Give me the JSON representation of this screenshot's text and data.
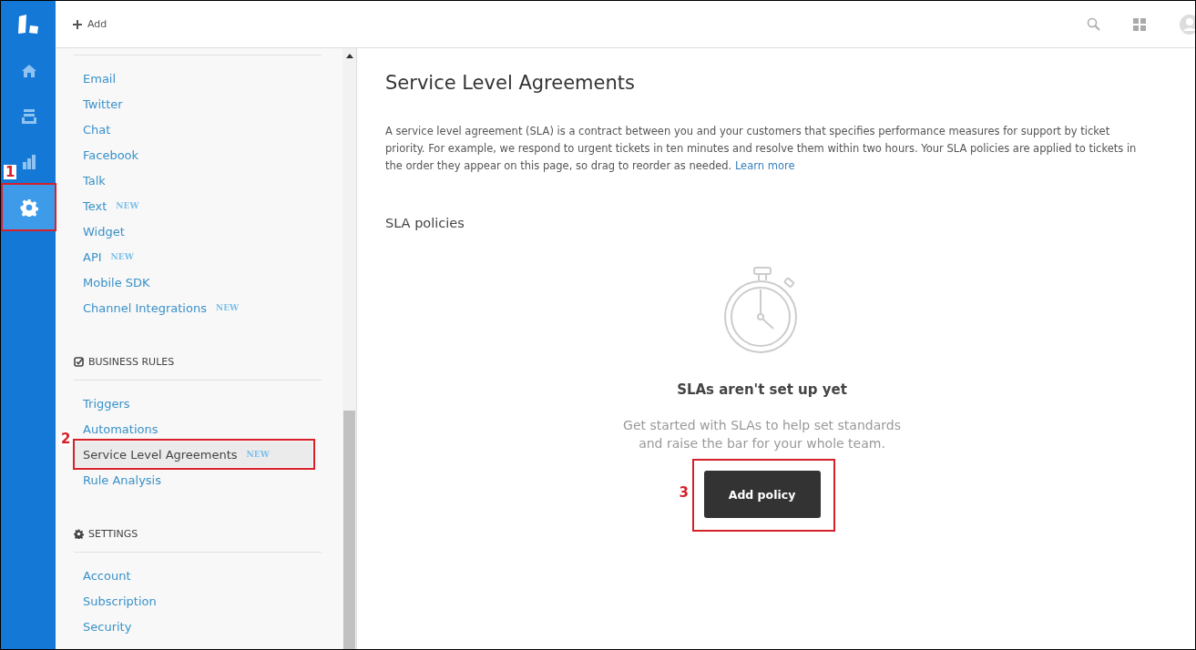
{
  "rail": {
    "items": [
      {
        "selected": false
      },
      {
        "selected": false
      },
      {
        "selected": false
      },
      {
        "selected": true,
        "callout": "1"
      }
    ]
  },
  "top_bar": {
    "add_label": "Add"
  },
  "sidebar": {
    "groups": [
      {
        "items": [
          {
            "label": "Email",
            "selected": false
          },
          {
            "label": "Twitter",
            "selected": false
          },
          {
            "label": "Chat",
            "selected": false
          },
          {
            "label": "Facebook",
            "selected": false
          },
          {
            "label": "Talk",
            "selected": false
          },
          {
            "label": "Text",
            "badge": "NEW",
            "selected": false
          },
          {
            "label": "Widget",
            "selected": false
          },
          {
            "label": "API",
            "badge": "NEW",
            "selected": false
          },
          {
            "label": "Mobile SDK",
            "selected": false
          },
          {
            "label": "Channel Integrations",
            "badge": "NEW",
            "selected": false
          }
        ]
      },
      {
        "title": "BUSINESS RULES",
        "kind": "check",
        "items": [
          {
            "label": "Triggers",
            "selected": false
          },
          {
            "label": "Automations",
            "selected": false
          },
          {
            "label": "Service Level Agreements",
            "badge": "NEW",
            "selected": true,
            "callout": "2"
          },
          {
            "label": "Rule Analysis",
            "selected": false
          }
        ]
      },
      {
        "title": "SETTINGS",
        "kind": "gear",
        "items": [
          {
            "label": "Account",
            "selected": false
          },
          {
            "label": "Subscription",
            "selected": false
          },
          {
            "label": "Security",
            "selected": false
          }
        ]
      }
    ]
  },
  "main": {
    "title": "Service Level Agreements",
    "description": "A service level agreement (SLA) is a contract between you and your customers that specifies performance measures for support by ticket priority. For example, we respond to urgent tickets in ten minutes and resolve them within two hours. Your SLA policies are applied to tickets in the order they appear on this page, so drag to reorder as needed.",
    "learn_more": "Learn more",
    "section_title": "SLA policies",
    "empty_state": {
      "heading": "SLAs aren't set up yet",
      "text_lines": [
        "Get started with SLAs to help set standards",
        "and raise the bar for your whole team."
      ],
      "button": "Add policy",
      "callout": "3"
    }
  }
}
